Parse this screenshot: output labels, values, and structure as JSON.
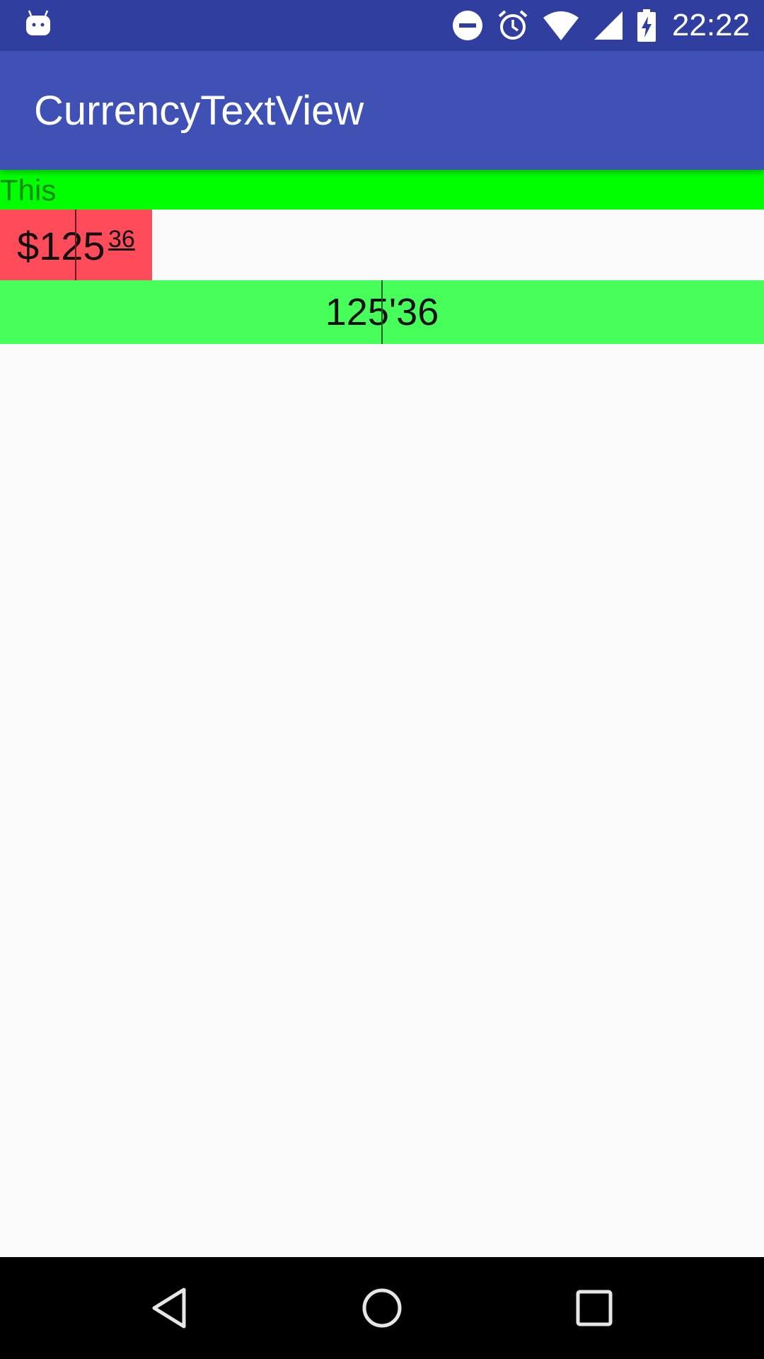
{
  "status_bar": {
    "time": "22:22",
    "icons": [
      "android-debug-icon",
      "do-not-disturb-icon",
      "alarm-icon",
      "wifi-icon",
      "signal-icon",
      "battery-charging-icon"
    ]
  },
  "app_bar": {
    "title": "CurrencyTextView"
  },
  "rows": {
    "this_label": "This",
    "price_main": "$125",
    "price_cents": "36",
    "total_value": "125'36"
  },
  "colors": {
    "status_bar": "#303f9f",
    "app_bar": "#3f51b5",
    "row_this": "#00ff00",
    "row_price": "#ff4b5a",
    "row_total": "#47ff5a",
    "background": "#fafafa",
    "nav_bar": "#000000"
  },
  "nav_bar": {
    "icons": [
      "back-icon",
      "home-icon",
      "recents-icon"
    ]
  }
}
